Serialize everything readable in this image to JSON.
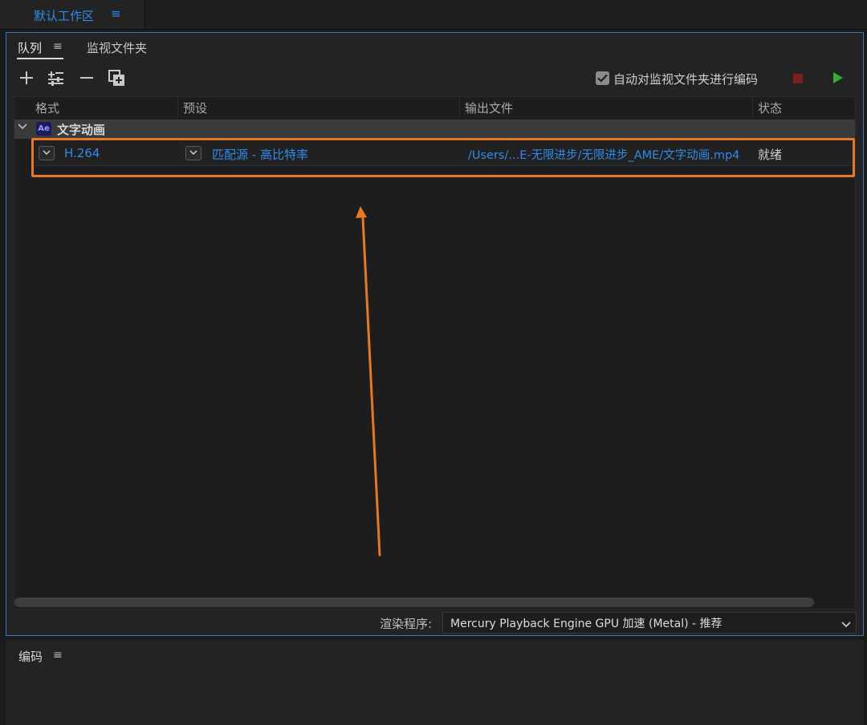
{
  "workspace": {
    "label": "默认工作区",
    "menu_icon": "hamburger-icon"
  },
  "queue_panel": {
    "tabs": [
      {
        "label": "队列",
        "active": true
      },
      {
        "label": "监视文件夹",
        "active": false
      }
    ],
    "toolbar": {
      "icons": [
        "add-icon",
        "add-preset-icon",
        "remove-icon",
        "duplicate-icon"
      ],
      "auto_encode_label": "自动对监视文件夹进行编码",
      "auto_encode_checked": true
    },
    "columns": [
      "格式",
      "预设",
      "输出文件",
      "状态"
    ],
    "group": {
      "badge": "Ae",
      "name": "文字动画"
    },
    "item": {
      "format": "H.264",
      "preset": "匹配源 - 高比特率",
      "output": "/Users/...E-无限进步/无限进步_AME/文字动画.mp4",
      "status": "就绪"
    },
    "renderer": {
      "label": "渲染程序:",
      "value": "Mercury Playback Engine GPU 加速 (Metal) - 推荐"
    }
  },
  "encode_panel": {
    "title": "编码"
  },
  "colors": {
    "accent": "#2d8ceb",
    "highlight": "#e8771e",
    "play": "#2fae2f",
    "stop": "#7a1f1f"
  }
}
